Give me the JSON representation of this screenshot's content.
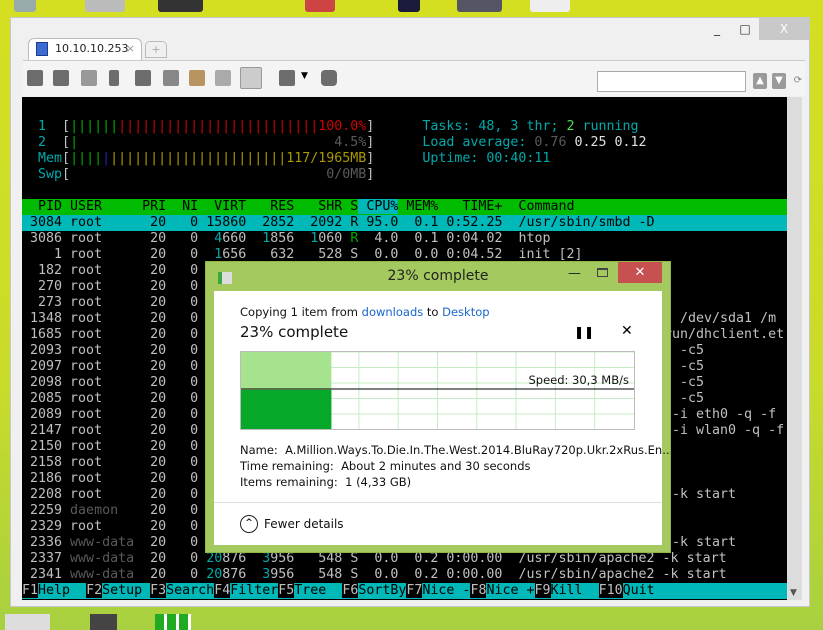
{
  "window": {
    "tab_label": "10.10.10.253",
    "tab_close": "×",
    "new_tab": "+",
    "minimize": "_",
    "maximize": "□",
    "close": "X",
    "search_placeholder": ""
  },
  "htop": {
    "meters": [
      {
        "label": "1",
        "percent": 100.0,
        "text": "100.0%",
        "green_fraction": 0.2
      },
      {
        "label": "2",
        "percent": 4.5,
        "text": "4.5%"
      },
      {
        "label": "Mem",
        "used_mb": 117,
        "total_mb": 1965,
        "text": "117/1965MB"
      },
      {
        "label": "Swp",
        "used_mb": 0,
        "total_mb": 0,
        "text": "0/0MB"
      }
    ],
    "tasks": {
      "prefix": "Tasks: ",
      "count": "48",
      "sep1": ", ",
      "thr": "3",
      "thr_label": " thr; ",
      "running": "2",
      "running_label": " running"
    },
    "load": {
      "label": "Load average: ",
      "l1": "0.76",
      "l5": "0.25",
      "l15": "0.12"
    },
    "uptime": {
      "label": "Uptime: ",
      "value": "00:40:11"
    },
    "columns": [
      "PID",
      "USER",
      "PRI",
      "NI",
      "VIRT",
      "RES",
      "SHR",
      "S",
      "CPU%",
      "MEM%",
      "TIME+",
      "Command"
    ],
    "sorted_column": "CPU%",
    "processes": [
      {
        "pid": "3084",
        "user": "root",
        "pri": "20",
        "ni": "0",
        "virt": "15860",
        "res": "2852",
        "shr": "2092",
        "s": "R",
        "cpu": "95.0",
        "mem": "0.1",
        "time": "0:52.25",
        "cmd": "/usr/sbin/smbd -D",
        "selected": true
      },
      {
        "pid": "3086",
        "user": "root",
        "pri": "20",
        "ni": "0",
        "virt": "4660",
        "res": "1856",
        "shr": "1060",
        "s": "R",
        "cpu": "4.0",
        "mem": "0.1",
        "time": "0:04.02",
        "cmd": "htop"
      },
      {
        "pid": "1",
        "user": "root",
        "pri": "20",
        "ni": "0",
        "virt": "1656",
        "res": "632",
        "shr": "528",
        "s": "S",
        "cpu": "0.0",
        "mem": "0.0",
        "time": "0:04.52",
        "cmd": "init [2]"
      },
      {
        "pid": "182",
        "user": "root",
        "pri": "20",
        "ni": "0"
      },
      {
        "pid": "270",
        "user": "root",
        "pri": "20",
        "ni": "0"
      },
      {
        "pid": "273",
        "user": "root",
        "pri": "20",
        "ni": "0"
      },
      {
        "pid": "1348",
        "user": "root",
        "pri": "20",
        "ni": "0",
        "tail": "g /dev/sda1 /m"
      },
      {
        "pid": "1685",
        "user": "root",
        "pri": "20",
        "ni": "0",
        "tail": "run/dhclient.et"
      },
      {
        "pid": "2093",
        "user": "root",
        "pri": "20",
        "ni": "0",
        "tail": "l -c5"
      },
      {
        "pid": "2097",
        "user": "root",
        "pri": "20",
        "ni": "0",
        "tail": "l -c5"
      },
      {
        "pid": "2098",
        "user": "root",
        "pri": "20",
        "ni": "0",
        "tail": "l -c5"
      },
      {
        "pid": "2085",
        "user": "root",
        "pri": "20",
        "ni": "0",
        "tail": "l -c5"
      },
      {
        "pid": "2089",
        "user": "root",
        "pri": "20",
        "ni": "0",
        "tail": " -i eth0 -q -f"
      },
      {
        "pid": "2147",
        "user": "root",
        "pri": "20",
        "ni": "0",
        "tail": " -i wlan0 -q -f"
      },
      {
        "pid": "2150",
        "user": "root",
        "pri": "20",
        "ni": "0"
      },
      {
        "pid": "2158",
        "user": "root",
        "pri": "20",
        "ni": "0"
      },
      {
        "pid": "2186",
        "user": "root",
        "pri": "20",
        "ni": "0"
      },
      {
        "pid": "2208",
        "user": "root",
        "pri": "20",
        "ni": "0",
        "tail": " -k start"
      },
      {
        "pid": "2259",
        "user": "daemon",
        "pri": "20",
        "ni": "0"
      },
      {
        "pid": "2329",
        "user": "root",
        "pri": "20",
        "ni": "0"
      },
      {
        "pid": "2336",
        "user": "www-data",
        "pri": "20",
        "ni": "0",
        "tail": " -k start"
      },
      {
        "pid": "2337",
        "user": "www-data",
        "pri": "20",
        "ni": "0",
        "virt": "20876",
        "res": "3956",
        "shr": "548",
        "s": "S",
        "cpu": "0.0",
        "mem": "0.2",
        "time": "0:00.00",
        "cmd": "/usr/sbin/apache2 -k start"
      },
      {
        "pid": "2341",
        "user": "www-data",
        "pri": "20",
        "ni": "0",
        "virt": "20876",
        "res": "3956",
        "shr": "548",
        "s": "S",
        "cpu": "0.0",
        "mem": "0.2",
        "time": "0:00.00",
        "cmd": "/usr/sbin/apache2 -k start"
      }
    ],
    "function_keys": [
      {
        "key": "F1",
        "label": "Help  "
      },
      {
        "key": "F2",
        "label": "Setup "
      },
      {
        "key": "F3",
        "label": "Search"
      },
      {
        "key": "F4",
        "label": "Filter"
      },
      {
        "key": "F5",
        "label": "Tree  "
      },
      {
        "key": "F6",
        "label": "SortBy"
      },
      {
        "key": "F7",
        "label": "Nice -"
      },
      {
        "key": "F8",
        "label": "Nice +"
      },
      {
        "key": "F9",
        "label": "Kill  "
      },
      {
        "key": "F10",
        "label": "Quit"
      }
    ]
  },
  "copy_dialog": {
    "title": "23% complete",
    "copying_prefix": "Copying 1 item from ",
    "source": "downloads",
    "to": " to ",
    "destination": "Desktop",
    "percent_label": "23% complete",
    "progress_percent": 23,
    "speed": "Speed: 30,3 MB/s",
    "name_label": "Name:",
    "name_value": "A.Million.Ways.To.Die.In.The.West.2014.BluRay720p.Ukr.2xRus.En...",
    "time_label": "Time remaining:",
    "time_value": "About 2 minutes and 30 seconds",
    "items_label": "Items remaining:",
    "items_value": "1 (4,33 GB)",
    "fewer_details": "Fewer details",
    "colors": {
      "border": "#a4c95e",
      "fill": "#06a82a",
      "fill_light": "#a6e38f",
      "close": "#c75050"
    }
  }
}
